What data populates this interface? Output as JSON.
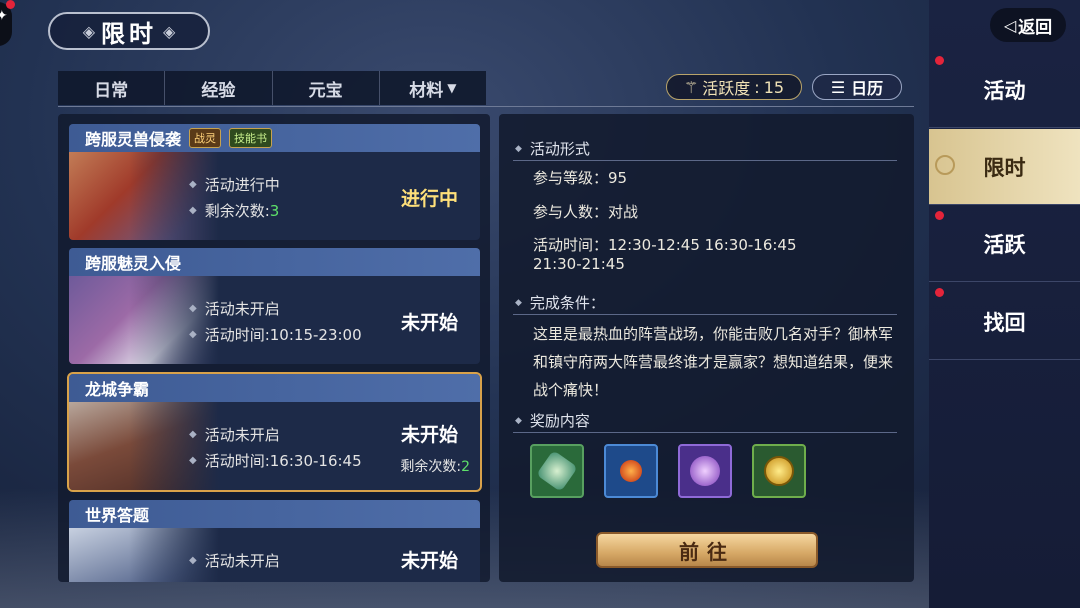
{
  "header": {
    "title": "限时"
  },
  "tabs": [
    {
      "label": "日常"
    },
    {
      "label": "经验"
    },
    {
      "label": "元宝"
    },
    {
      "label": "材料",
      "has_dropdown": true
    }
  ],
  "activity": {
    "label": "活跃度",
    "value": "15"
  },
  "calendar_label": "日历",
  "back_label": "返回",
  "sidebar": {
    "items": [
      {
        "label": "活动",
        "has_dot": true
      },
      {
        "label": "限时",
        "active": true
      },
      {
        "label": "活跃",
        "has_dot": true
      },
      {
        "label": "找回",
        "has_dot": true
      }
    ]
  },
  "events": [
    {
      "name": "跨服灵兽侵袭",
      "tags": [
        "战灵",
        "技能书"
      ],
      "line1": "活动进行中",
      "line2_label": "剩余次数:",
      "line2_value": "3",
      "status": "进行中",
      "live": true
    },
    {
      "name": "跨服魅灵入侵",
      "tags": [],
      "line1": "活动未开启",
      "line2_label": "活动时间:10:15-23:00",
      "line2_value": "",
      "status": "未开始"
    },
    {
      "name": "龙城争霸",
      "tags": [],
      "line1": "活动未开启",
      "line2_label": "活动时间:16:30-16:45",
      "line2_value": "",
      "status": "未开始",
      "remain_label": "剩余次数:",
      "remain_value": "2",
      "selected": true
    },
    {
      "name": "世界答题",
      "tags": [],
      "line1": "活动未开启",
      "line2_label": "",
      "line2_value": "",
      "status": "未开始"
    }
  ],
  "detail": {
    "form_title": "活动形式",
    "level": "参与等级：95",
    "players": "参与人数：对战",
    "time_line1": "活动时间：12:30-12:45  16:30-16:45",
    "time_line2": "21:30-21:45",
    "condition_title": "完成条件：",
    "description": "这里是最热血的阵营战场，你能击败几名对手？御林军和镇守府两大阵营最终谁才是赢家？想知道结果，便来战个痛快！",
    "reward_title": "奖励内容",
    "rewards": [
      {
        "icon": "jade-fan-icon"
      },
      {
        "icon": "fire-orb-icon"
      },
      {
        "icon": "purple-pouch-icon"
      },
      {
        "icon": "gold-coin-icon"
      }
    ],
    "go_label": "前往"
  },
  "colors": {
    "accent_gold": "#d9a24a",
    "live_status": "#ffe07a",
    "count_green": "#5ee06a",
    "badge_red": "#e4243a"
  }
}
